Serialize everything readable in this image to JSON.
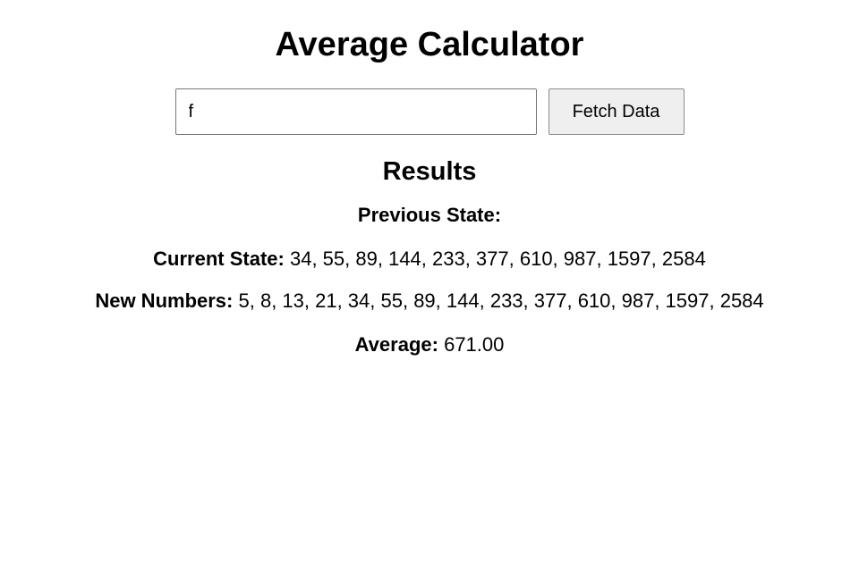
{
  "header": {
    "title": "Average Calculator"
  },
  "controls": {
    "input_value": "f",
    "fetch_button_label": "Fetch Data"
  },
  "results": {
    "heading": "Results",
    "previous_state": {
      "label": "Previous State:",
      "value": ""
    },
    "current_state": {
      "label": "Current State:",
      "value": "34, 55, 89, 144, 233, 377, 610, 987, 1597, 2584"
    },
    "new_numbers": {
      "label": "New Numbers:",
      "value": "5, 8, 13, 21, 34, 55, 89, 144, 233, 377, 610, 987, 1597, 2584"
    },
    "average": {
      "label": "Average:",
      "value": "671.00"
    }
  }
}
